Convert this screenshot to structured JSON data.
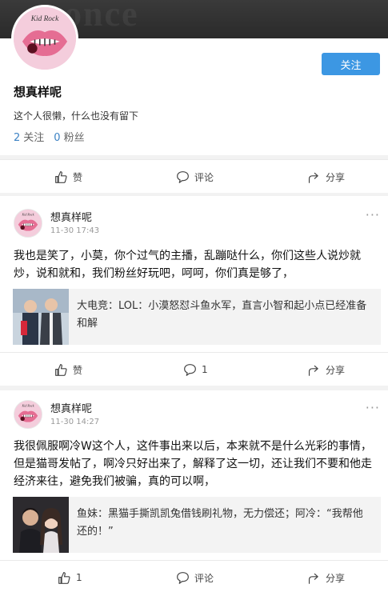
{
  "cover": {
    "watermark": "once"
  },
  "profile": {
    "name": "想真样呢",
    "bio": "这个人很懒，什么也没有留下",
    "follow_label": "关注",
    "following_count": "2",
    "following_label": "关注",
    "fans_count": "0",
    "fans_label": "粉丝"
  },
  "actions": {
    "like": "赞",
    "comment": "评论",
    "share": "分享"
  },
  "posts": [
    {
      "user": "想真样呢",
      "time": "11-30 17:43",
      "text": "我也是笑了，小莫，你个过气的主播，乱蹦哒什么，你们这些人说炒就炒，说和就和，我们粉丝好玩吧，呵呵，你们真是够了，",
      "card_text": "大电竞：LOL：小漠怒怼斗鱼水军，直言小智和起小点已经准备和解",
      "like_label": "赞",
      "comment_label": "1",
      "share_label": "分享"
    },
    {
      "user": "想真样呢",
      "time": "11-30 14:27",
      "text": "我很佩服啊冷W这个人，这件事出来以后，本来就不是什么光彩的事情，但是猫哥发帖了，啊冷只好出来了，解释了这一切，还让我们不要和他走经济来往，避免我们被骗，真的可以啊，",
      "card_text": "鱼妹：黑猫手撕凯凯兔借钱刷礼物，无力偿还；阿冷：“我帮他还的！”",
      "like_label": "1",
      "comment_label": "评论",
      "share_label": "分享"
    }
  ],
  "colors": {
    "accent": "#3c97e3",
    "link": "#3c82c4"
  }
}
